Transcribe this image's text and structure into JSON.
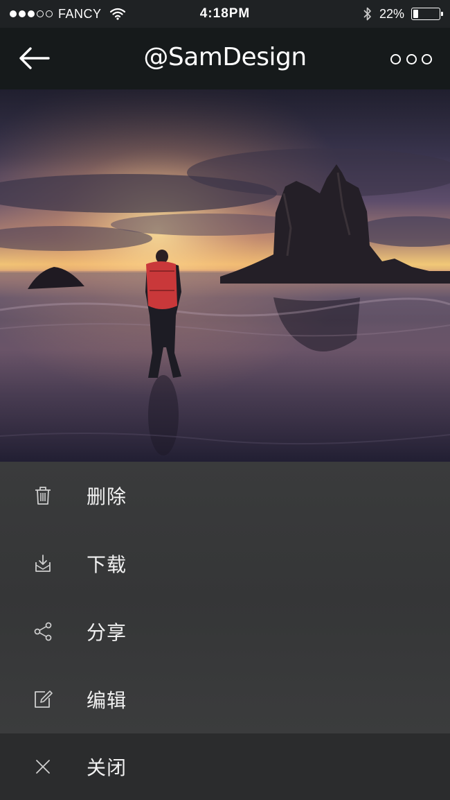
{
  "status_bar": {
    "carrier": "FANCY",
    "time": "4:18PM",
    "battery_percent": "22%",
    "battery_level": 0.22,
    "signal_bars_filled": 3,
    "signal_bars_total": 5
  },
  "nav": {
    "title": "@SamDesign",
    "back_icon": "arrow-left-icon",
    "more_icon": "more-dots-icon"
  },
  "sheet": {
    "items": [
      {
        "label": "删除",
        "icon": "trash-icon"
      },
      {
        "label": "下载",
        "icon": "download-icon"
      },
      {
        "label": "分享",
        "icon": "share-icon"
      },
      {
        "label": "编辑",
        "icon": "edit-icon"
      }
    ],
    "close": {
      "label": "关闭",
      "icon": "close-icon"
    }
  },
  "colors": {
    "status_bar_bg": "#1f2224",
    "nav_bg": "#161a1b",
    "sheet_bg": "#383939",
    "close_bg": "#2b2c2d",
    "text": "#ffffff"
  }
}
